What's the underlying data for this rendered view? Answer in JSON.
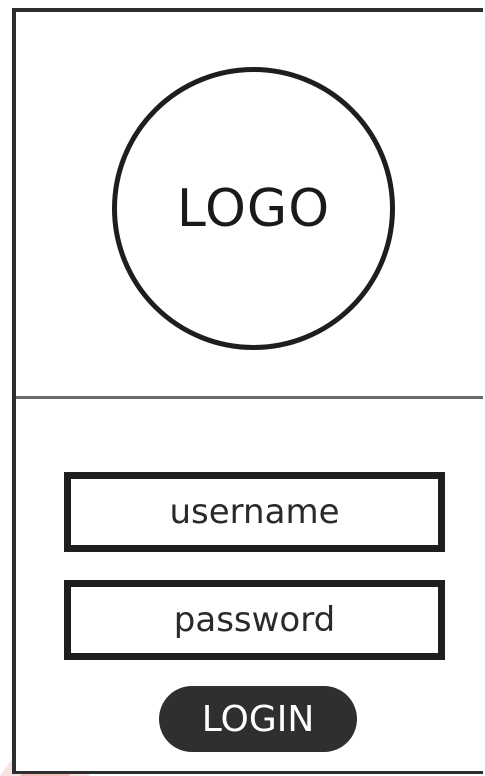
{
  "logo": {
    "text": "LOGO"
  },
  "login_form": {
    "username_placeholder": "username",
    "password_placeholder": "password",
    "login_label": "LOGIN"
  },
  "colors": {
    "border": "#1e1e1e",
    "divider": "#6a6a6a",
    "button_bg": "#2f2f2f",
    "button_text": "#ffffff",
    "watermark_red": "#d9302a"
  }
}
